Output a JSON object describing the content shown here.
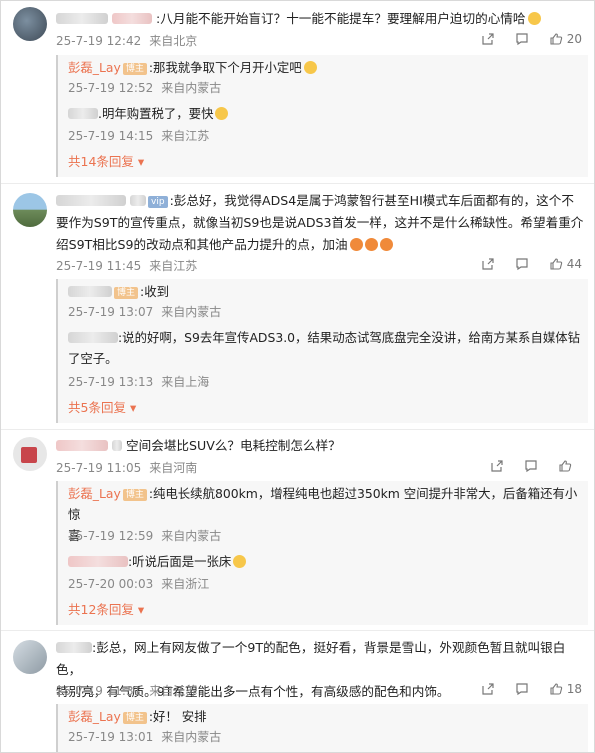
{
  "comments": [
    {
      "text": ":八月能不能开始盲订？十一能不能提车？要理解用户迫切的心情哈",
      "date": "25-7-19 12:42",
      "loc": "来自北京",
      "likes": "20",
      "replies": [
        {
          "name": "彭磊_Lay",
          "text": ":那我就争取下个月开小定吧",
          "date": "25-7-19 12:52",
          "loc": "来自内蒙古"
        },
        {
          "name": "",
          "text": ".明年购置税了，要快",
          "date": "25-7-19 14:15",
          "loc": "来自江苏"
        }
      ],
      "more": "共14条回复"
    },
    {
      "text_line1": ":彭总好，我觉得ADS4是属于鸿蒙智行甚至HI模式车后面都有的，这个不",
      "text_line2": "要作为S9T的宣传重点，就像当初S9也是说ADS3首发一样，这并不是什么稀缺性。希望着重介",
      "text_line3": "绍S9T相比S9的改动点和其他产品力提升的点，加油",
      "date": "25-7-19 11:45",
      "loc": "来自江苏",
      "likes": "44",
      "replies": [
        {
          "name": "彭磊_Lay",
          "text": ":收到",
          "date": "25-7-19 13:07",
          "loc": "来自内蒙古"
        },
        {
          "name": "",
          "text_line1": ":说的好啊，S9去年宣传ADS3.0，结果动态试驾底盘完全没讲，给南方某系自媒体钻",
          "text_line2": "了空子。",
          "date": "25-7-19 13:13",
          "loc": "来自上海"
        }
      ],
      "more": "共5条回复"
    },
    {
      "text": "空间会堪比SUV么？电耗控制怎么样？",
      "date": "25-7-19 11:05",
      "loc": "来自河南",
      "replies": [
        {
          "name": "彭磊_Lay",
          "text_line1": ":纯电长续航800km，增程纯电也超过350km 空间提升非常大，后备箱还有小惊",
          "text_line2": "喜",
          "date": "25-7-19 12:59",
          "loc": "来自内蒙古"
        },
        {
          "name": "",
          "text": ":听说后面是一张床",
          "date": "25-7-20 00:03",
          "loc": "来自浙江"
        }
      ],
      "more": "共12条回复"
    },
    {
      "text_line1": ":彭总，网上有网友做了一个9T的配色，挺好看，背景是雪山，外观颜色暂且就叫银白色，",
      "text_line2": "特别亮，有气质。9T希望能出多一点有个性，有高级感的配色和内饰。",
      "date": "25-7-19 11:31",
      "loc": "来自江苏",
      "likes": "18",
      "replies": [
        {
          "name": "彭磊_Lay",
          "text": ":好！ 安排",
          "date": "25-7-19 13:01",
          "loc": "来自内蒙古"
        }
      ]
    }
  ],
  "badge": "博主",
  "colors": {
    "accent": "#eb7350",
    "meta": "#888888",
    "reply_bg": "#f7f7f7"
  },
  "icons": [
    "share-icon",
    "comment-icon",
    "like-icon",
    "chevron-down-icon",
    "emoji-icon"
  ]
}
